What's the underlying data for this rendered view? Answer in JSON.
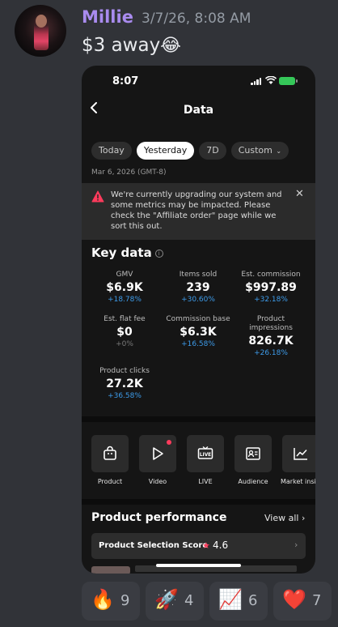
{
  "message": {
    "username": "Millie",
    "timestamp": "3/7/26, 8:08 AM",
    "text": "$3 away",
    "text_emoji": "😂"
  },
  "phone": {
    "status_time": "8:07",
    "nav_title": "Data",
    "tabs": [
      {
        "label": "Today",
        "active": false
      },
      {
        "label": "Yesterday",
        "active": true
      },
      {
        "label": "7D",
        "active": false
      },
      {
        "label": "Custom",
        "active": false
      }
    ],
    "date_label": "Mar 6, 2026 (GMT-8)",
    "banner_text": "We're currently upgrading our system and some metrics may be impacted. Please check the \"Affiliate order\" page while we sort this out.",
    "key_data_title": "Key data",
    "metrics": [
      {
        "label": "GMV",
        "value": "$6.9K",
        "change": "+18.78%"
      },
      {
        "label": "Items sold",
        "value": "239",
        "change": "+30.60%"
      },
      {
        "label": "Est. commission",
        "value": "$997.89",
        "change": "+32.18%"
      },
      {
        "label": "Est. flat fee",
        "value": "$0",
        "change": "+0%"
      },
      {
        "label": "Commission base",
        "value": "$6.3K",
        "change": "+16.58%"
      },
      {
        "label": "Product impressions",
        "value": "826.7K",
        "change": "+26.18%"
      },
      {
        "label": "Product clicks",
        "value": "27.2K",
        "change": "+36.58%"
      }
    ],
    "tools": [
      {
        "label": "Product",
        "icon": "bag-icon"
      },
      {
        "label": "Video",
        "icon": "play-icon"
      },
      {
        "label": "LIVE",
        "icon": "live-tv-icon"
      },
      {
        "label": "Audience",
        "icon": "id-card-icon"
      },
      {
        "label": "Market insi",
        "icon": "chart-icon"
      }
    ],
    "product_performance_title": "Product performance",
    "view_all_label": "View all",
    "psc_label": "Product Selection Score",
    "psc_score": "4.6"
  },
  "reactions": [
    {
      "emoji": "🔥",
      "count": "9"
    },
    {
      "emoji": "🚀",
      "count": "4"
    },
    {
      "emoji": "📈",
      "count": "6"
    },
    {
      "emoji": "❤️",
      "count": "7"
    }
  ],
  "colors": {
    "username": "#a98bef",
    "change_positive": "#3d9be9",
    "accent_red": "#ff3b5c"
  }
}
